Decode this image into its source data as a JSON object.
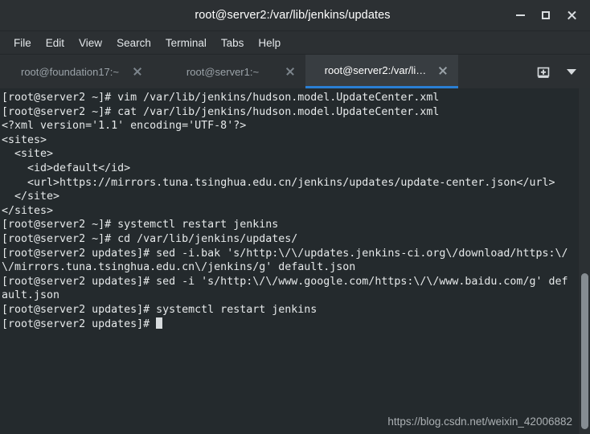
{
  "window": {
    "title": "root@server2:/var/lib/jenkins/updates",
    "controls": [
      {
        "name": "minimize-button",
        "label": "–"
      },
      {
        "name": "maximize-button",
        "label": "□"
      },
      {
        "name": "close-button",
        "label": "✕"
      }
    ]
  },
  "menubar": {
    "items": [
      {
        "label": "File"
      },
      {
        "label": "Edit"
      },
      {
        "label": "View"
      },
      {
        "label": "Search"
      },
      {
        "label": "Terminal"
      },
      {
        "label": "Tabs"
      },
      {
        "label": "Help"
      }
    ]
  },
  "tabbar": {
    "tabs": [
      {
        "label": "root@foundation17:~",
        "active": false
      },
      {
        "label": "root@server1:~",
        "active": false
      },
      {
        "label": "root@server2:/var/li…",
        "active": true
      }
    ],
    "new_tab_icon": "new-tab-icon",
    "menu_icon": "chevron-down-icon",
    "active_tab_accent": "#2a7fd4"
  },
  "terminal": {
    "background": "#242a2d",
    "foreground": "#e6e9ea",
    "content": "[root@server2 ~]# vim /var/lib/jenkins/hudson.model.UpdateCenter.xml\n[root@server2 ~]# cat /var/lib/jenkins/hudson.model.UpdateCenter.xml\n<?xml version='1.1' encoding='UTF-8'?>\n<sites>\n  <site>\n    <id>default</id>\n    <url>https://mirrors.tuna.tsinghua.edu.cn/jenkins/updates/update-center.json</url>\n  </site>\n</sites>\n[root@server2 ~]# systemctl restart jenkins\n[root@server2 ~]# cd /var/lib/jenkins/updates/\n[root@server2 updates]# sed -i.bak 's/http:\\/\\/updates.jenkins-ci.org\\/download/https:\\/\\/mirrors.tuna.tsinghua.edu.cn\\/jenkins/g' default.json\n[root@server2 updates]# sed -i 's/http:\\/\\/www.google.com/https:\\/\\/www.baidu.com/g' default.json\n[root@server2 updates]# systemctl restart jenkins\n[root@server2 updates]# ",
    "cursor": "block"
  },
  "scrollbar": {
    "name": "terminal-scrollbar"
  },
  "watermark": {
    "text": "https://blog.csdn.net/weixin_42006882"
  }
}
